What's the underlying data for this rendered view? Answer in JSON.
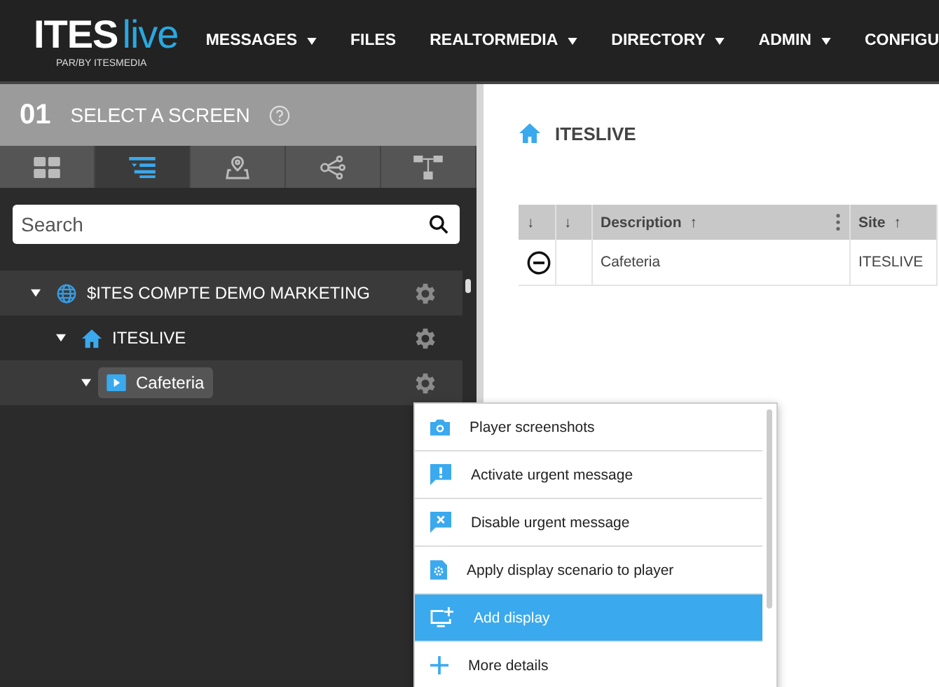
{
  "header": {
    "logo": {
      "brand": "ITES",
      "accent": "live",
      "tagline": "PAR/BY ITESMEDIA"
    },
    "nav": [
      {
        "label": "MESSAGES",
        "has_dropdown": true
      },
      {
        "label": "FILES",
        "has_dropdown": false
      },
      {
        "label": "REALTORMEDIA",
        "has_dropdown": true
      },
      {
        "label": "DIRECTORY",
        "has_dropdown": true
      },
      {
        "label": "ADMIN",
        "has_dropdown": true
      },
      {
        "label": "CONFIGU",
        "has_dropdown": false
      }
    ]
  },
  "sidebar": {
    "step": "01",
    "title": "SELECT A SCREEN",
    "tabs": [
      {
        "kind": "grid",
        "selected": false
      },
      {
        "kind": "list",
        "selected": true
      },
      {
        "kind": "map",
        "selected": false
      },
      {
        "kind": "share",
        "selected": false
      },
      {
        "kind": "hierarchy",
        "selected": false
      }
    ],
    "search": {
      "placeholder": "Search"
    },
    "tree": [
      {
        "label": "$ITES COMPTE DEMO MARKETING",
        "kind": "account",
        "expanded": true,
        "selected": false,
        "children": [
          {
            "label": "ITESLIVE",
            "kind": "site",
            "expanded": true,
            "selected": false,
            "children": [
              {
                "label": "Cafeteria",
                "kind": "player",
                "expanded": true,
                "selected": true
              }
            ]
          }
        ]
      }
    ]
  },
  "main": {
    "title": "ITESLIVE",
    "table": {
      "columns": [
        {
          "label": "↓"
        },
        {
          "label": "↓"
        },
        {
          "label": "Description",
          "sort": "↑",
          "has_menu": true
        },
        {
          "label": "Site",
          "sort": "↑",
          "has_menu": false
        }
      ],
      "rows": [
        {
          "removable": true,
          "description": "Cafeteria",
          "site": "ITESLIVE"
        }
      ]
    }
  },
  "context_menu": {
    "items": [
      {
        "kind": "camera",
        "label": "Player screenshots",
        "selected": false
      },
      {
        "kind": "alert",
        "label": "Activate urgent message",
        "selected": false
      },
      {
        "kind": "cancel",
        "label": "Disable urgent message",
        "selected": false
      },
      {
        "kind": "scenario",
        "label": "Apply display scenario to player",
        "selected": false
      },
      {
        "kind": "add-display",
        "label": "Add display",
        "selected": true
      },
      {
        "kind": "plus",
        "label": "More details",
        "selected": false
      }
    ]
  }
}
